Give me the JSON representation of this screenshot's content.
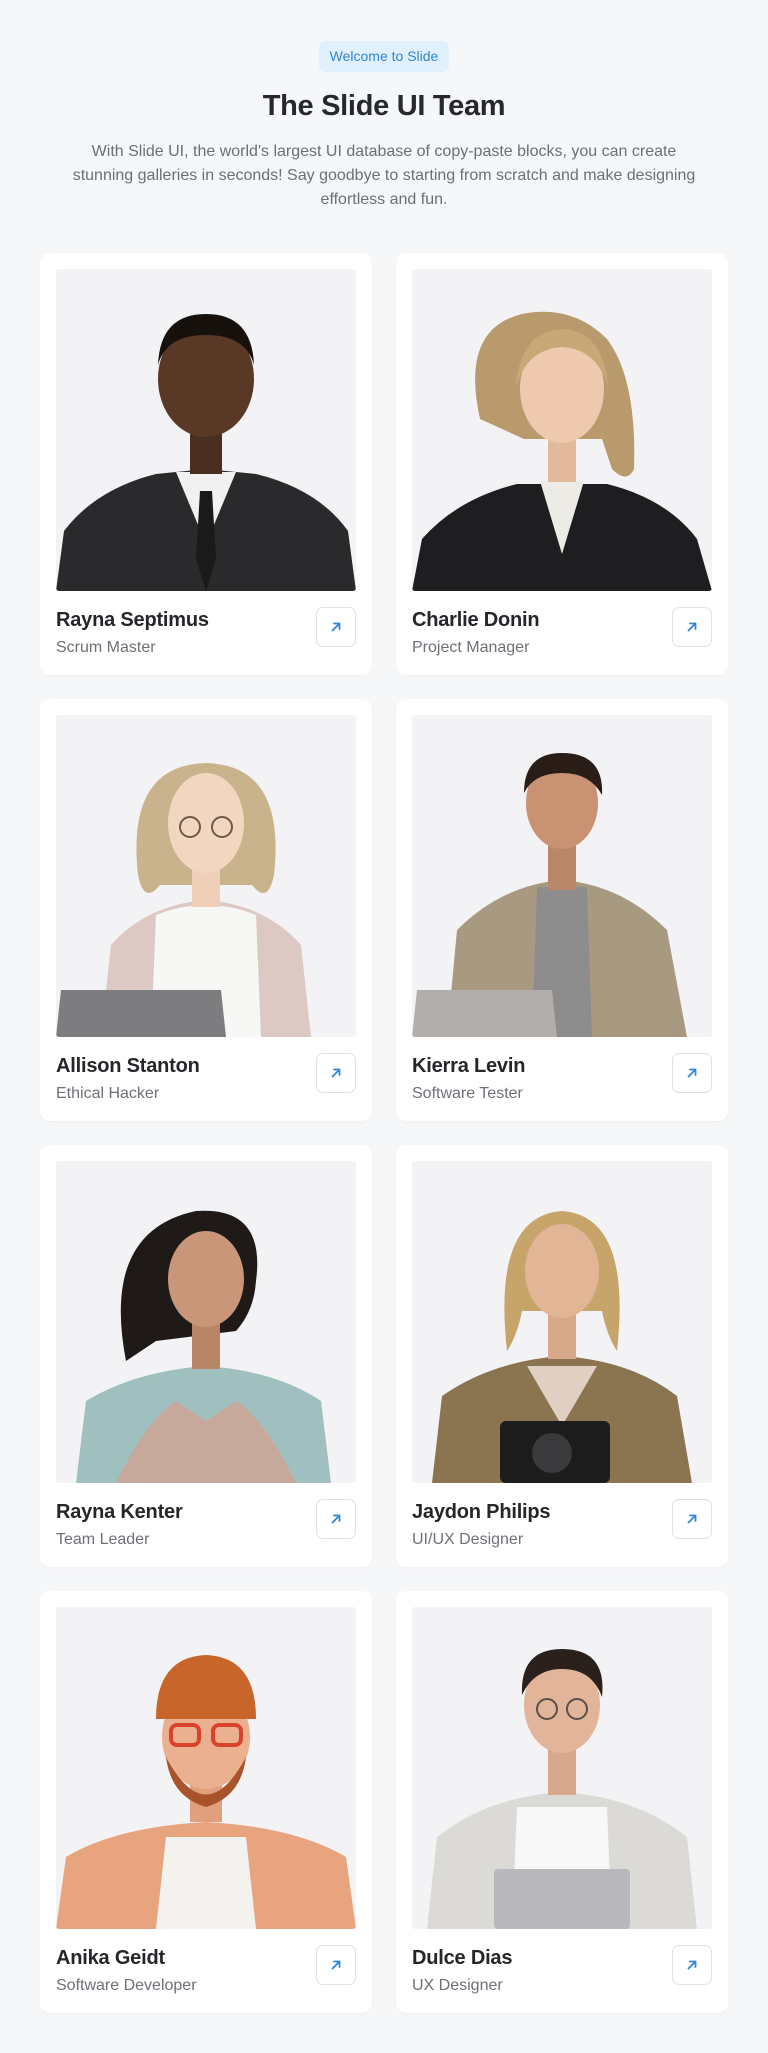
{
  "header": {
    "badge": "Welcome to Slide",
    "title": "The Slide UI Team",
    "subtitle": "With Slide UI, the world's largest UI database of copy-paste blocks, you can create stunning galleries in seconds! Say goodbye to starting from scratch and make designing effortless and fun."
  },
  "accent_color": "#2f86d6",
  "link_icon": "arrow-up-right-icon",
  "team": [
    {
      "name": "Rayna Septimus",
      "role": "Scrum Master"
    },
    {
      "name": "Charlie Donin",
      "role": "Project Manager"
    },
    {
      "name": "Allison Stanton",
      "role": "Ethical Hacker"
    },
    {
      "name": "Kierra Levin",
      "role": "Software Tester"
    },
    {
      "name": "Rayna Kenter",
      "role": "Team Leader"
    },
    {
      "name": "Jaydon Philips",
      "role": "UI/UX Designer"
    },
    {
      "name": "Anika Geidt",
      "role": "Software Developer"
    },
    {
      "name": "Dulce Dias",
      "role": "UX Designer"
    }
  ]
}
